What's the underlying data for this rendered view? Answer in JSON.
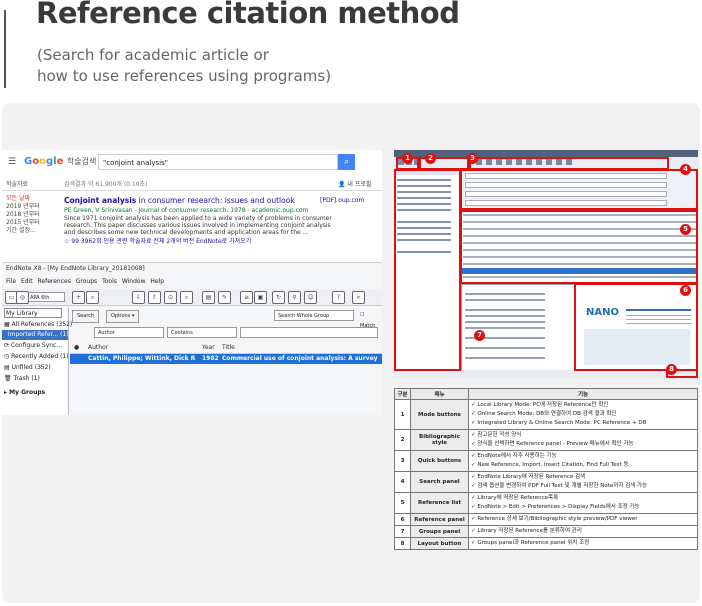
{
  "header": {
    "title": "Reference citation method",
    "subtitle_line1": "(Search for academic article or",
    "subtitle_line2": "how to use references using programs)"
  },
  "scholar": {
    "logo_google": [
      "G",
      "o",
      "o",
      "g",
      "l",
      "e"
    ],
    "logo_suffix": "학술검색",
    "query": "\"conjoint analysis\"",
    "results_label": "학술자료",
    "results_count": "검색결과 약 61,900개 (0.10초)",
    "my_profile": "내 프로필",
    "side_filters": [
      "모든 날짜",
      "2019 년부터",
      "2018 년부터",
      "2015 년부터",
      "기간 설정..."
    ],
    "result_title_bold": "Conjoint analysis",
    "result_title_rest": " in consumer research: issues and outlook",
    "result_source": "[PDF] oup.com",
    "result_authors": "PE Green, V Srinivasan - Journal of consumer research, 1978 - academic.oup.com",
    "snippet_lines": [
      "Since 1971 conjoint analysis has been applied to a wide variety of problems in consumer",
      "research. This paper discusses various issues involved in implementing conjoint analysis",
      "and describes some new technical developments and application areas for the ..."
    ],
    "result_links": "☆  99  3962회 인용  관련 학술자료  전체 2개의 버전  EndNote로 가져오기"
  },
  "endnote": {
    "window_title": "EndNote X8 - [My EndNote Library_20181008]",
    "menu": [
      "File",
      "Edit",
      "References",
      "Groups",
      "Tools",
      "Window",
      "Help"
    ],
    "style_select": "APA 6th",
    "library_dropdown": "My Library",
    "search_button": "Search",
    "options_button": "Options ▾",
    "search_scope": "Search Whole Group",
    "match_case": "Match",
    "field_dropdown": "Author",
    "operator_dropdown": "Contains",
    "sidebar": [
      {
        "label": "All References",
        "count": "(352)"
      },
      {
        "label": "Imported Refer...",
        "count": "(1)"
      },
      {
        "label": "Configure Sync...",
        "count": ""
      },
      {
        "label": "Recently Added",
        "count": "(1)"
      },
      {
        "label": "Unfiled",
        "count": "(352)"
      },
      {
        "label": "Trash",
        "count": "(1)"
      },
      {
        "label": "My Groups",
        "count": ""
      }
    ],
    "columns": {
      "author": "Author",
      "year": "Year",
      "title": "Title"
    },
    "selected_row": {
      "author": "Cattin, Philippe; Wittink, Dick R",
      "year": "1982",
      "title": "Commercial use of conjoint analysis: A survey"
    }
  },
  "callouts": [
    "1",
    "2",
    "3",
    "4",
    "5",
    "6",
    "7",
    "8"
  ],
  "table": {
    "headers": [
      "구분",
      "메뉴",
      "기능"
    ],
    "rows": [
      {
        "no": "1",
        "menu": "Mode buttons",
        "lines": [
          "✓  Local Library Mode: PC에 저장된 Reference만 확인",
          "✓  Online Search Mode: DB와 연결하여 DB 검색 결과 확인",
          "✓  Integrated Library & Online Search Mode: PC Reference + DB"
        ]
      },
      {
        "no": "2",
        "menu": "Bibliographic style",
        "lines": [
          "✓  참고문헌 작성 양식",
          "✓  양식을 선택하면 Reference panel - Preview 메뉴에서 확인 가능"
        ]
      },
      {
        "no": "3",
        "menu": "Quick buttons",
        "lines": [
          "✓  EndNote에서 자주 사용하는 기능",
          "✓  New Reference, Import, Insert Citation, Find Full Text 등"
        ]
      },
      {
        "no": "4",
        "menu": "Search panel",
        "lines": [
          "✓  EndNote Library에 저장된 Reference 검색",
          "✓  검색 옵션을 변경하여 PDF Full Text 및 개별 저장한 Note까지 검색 가능"
        ]
      },
      {
        "no": "5",
        "menu": "Reference list",
        "lines": [
          "✓  Library에 저장된 Reference목록",
          "✓  EndNote > Edit > Preferences > Display Fields에서 조정 가능"
        ]
      },
      {
        "no": "6",
        "menu": "Reference panel",
        "lines": [
          "✓  Reference 상세 보기/Bibliographic style preview/PDF viewer"
        ]
      },
      {
        "no": "7",
        "menu": "Groups panel",
        "lines": [
          "✓  Library 저장된 Reference를 분류하여 관리"
        ]
      },
      {
        "no": "8",
        "menu": "Layout button",
        "lines": [
          "✓  Groups panel과 Reference panel 위치 조정"
        ]
      }
    ]
  },
  "colors": {
    "callout": "#e01010",
    "google_blue": "#4285f4",
    "endnote_select": "#1e6fd9"
  }
}
